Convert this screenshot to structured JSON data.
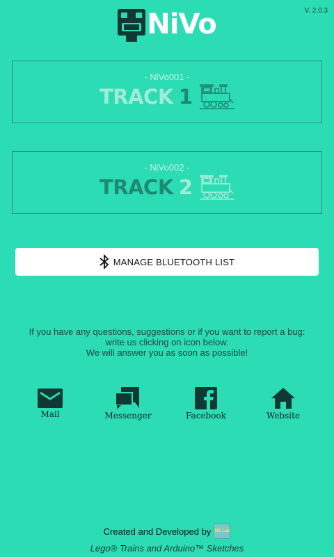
{
  "app": {
    "name": "NiVo",
    "version": "V. 2.0.3"
  },
  "tracks": [
    {
      "id_label": "- NiVo001 -",
      "label": "TRACK",
      "number": "1"
    },
    {
      "id_label": "- NiVo002 -",
      "label": "TRACK",
      "number": "2"
    }
  ],
  "bluetooth_button": {
    "label": "MANAGE BLUETOOTH LIST",
    "icon": "bluetooth-icon"
  },
  "info": {
    "line1": "If you have any questions, suggestions or if you want to report a bug:",
    "line2": "write us clicking on icon below.",
    "line3": "We will answer you as soon as possible!"
  },
  "contacts": [
    {
      "label": "Mail",
      "icon": "mail-icon"
    },
    {
      "label": "Messenger",
      "icon": "messenger-icon"
    },
    {
      "label": "Facebook",
      "icon": "facebook-icon"
    },
    {
      "label": "Website",
      "icon": "home-icon"
    }
  ],
  "footer": {
    "credit": "Created and Developed by",
    "badge": "MB Lab",
    "tagline": "Lego® Trains and Arduino™ Sketches"
  },
  "colors": {
    "background": "#2bdcb4",
    "dark": "#0f3a33",
    "light_text": "#a2ecd7",
    "teal_text": "#1d8a72"
  }
}
